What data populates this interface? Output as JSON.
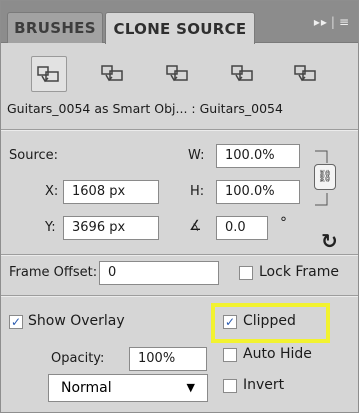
{
  "tabs": {
    "brushes": "BRUSHES",
    "clone_source": "CLONE SOURCE"
  },
  "flyout": {
    "collapse": "▸▸",
    "menu": "≡"
  },
  "source_label_text": "Guitars_0054 as Smart Obj... : Guitars_0054",
  "offset": {
    "source_label": "Source:",
    "x_label": "X:",
    "x_value": "1608 px",
    "y_label": "Y:",
    "y_value": "3696 px",
    "w_label": "W:",
    "w_value": "100.0%",
    "h_label": "H:",
    "h_value": "100.0%",
    "angle_value": "0.0",
    "degree_symbol": "°"
  },
  "frame": {
    "label": "Frame Offset:",
    "value": "0",
    "lock_label": "Lock Frame",
    "lock_checked": false
  },
  "overlay": {
    "show_label": "Show Overlay",
    "show_checked": true,
    "opacity_label": "Opacity:",
    "opacity_value": "100%",
    "blend_mode": "Normal",
    "clipped_label": "Clipped",
    "clipped_checked": true,
    "auto_hide_label": "Auto Hide",
    "auto_hide_checked": false,
    "invert_label": "Invert",
    "invert_checked": false
  },
  "colors": {
    "highlight": "#f2f230"
  }
}
